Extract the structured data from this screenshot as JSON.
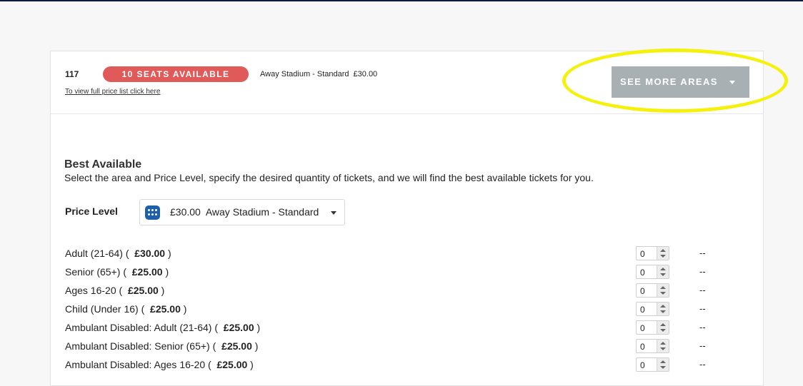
{
  "header": {
    "area_number": "117",
    "seats_badge": "10 SEATS AVAILABLE",
    "area_name": "Away Stadium - Standard",
    "area_price": "£30.00",
    "price_list_link": "To view full price list click here",
    "see_more_label": "SEE MORE AREAS"
  },
  "best_available": {
    "title": "Best Available",
    "description": "Select the area and Price Level, specify the desired quantity of tickets, and we will find the best available tickets for you."
  },
  "price_level": {
    "label": "Price Level",
    "selected": "£30.00  Away Stadium - Standard"
  },
  "tickets": [
    {
      "name": "Adult (21-64) (",
      "price": "£30.00",
      "close": " )",
      "qty": "0",
      "total": "--"
    },
    {
      "name": "Senior (65+) (",
      "price": "£25.00",
      "close": " )",
      "qty": "0",
      "total": "--"
    },
    {
      "name": "Ages 16-20 (",
      "price": "£25.00",
      "close": " )",
      "qty": "0",
      "total": "--"
    },
    {
      "name": "Child (Under 16) (",
      "price": "£25.00",
      "close": " )",
      "qty": "0",
      "total": "--"
    },
    {
      "name": "Ambulant Disabled: Adult (21-64) (",
      "price": "£25.00",
      "close": " )",
      "qty": "0",
      "total": "--"
    },
    {
      "name": "Ambulant Disabled: Senior (65+) (",
      "price": "£25.00",
      "close": " )",
      "qty": "0",
      "total": "--"
    },
    {
      "name": "Ambulant Disabled: Ages 16-20 (",
      "price": "£25.00",
      "close": " )",
      "qty": "0",
      "total": "--"
    }
  ],
  "colors": {
    "badge": "#e05a5a",
    "see_more": "#a8b0b3",
    "highlight": "#f4f10c",
    "icon": "#1d5fa8"
  },
  "icons": {
    "price_level": "seat-map-icon",
    "select_caret": "caret-down-icon"
  }
}
